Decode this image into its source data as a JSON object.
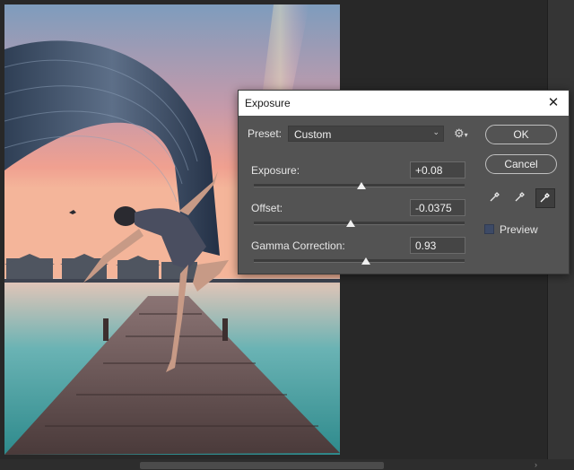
{
  "dialog": {
    "title": "Exposure",
    "preset_label": "Preset:",
    "preset_value": "Custom",
    "ok_label": "OK",
    "cancel_label": "Cancel",
    "preview_label": "Preview",
    "preview_checked": true,
    "exposure": {
      "label": "Exposure:",
      "value": "+0.08",
      "slider_fraction": 0.51
    },
    "offset": {
      "label": "Offset:",
      "value": "-0.0375",
      "slider_fraction": 0.46
    },
    "gamma": {
      "label": "Gamma Correction:",
      "value": "0.93",
      "slider_fraction": 0.53
    }
  },
  "colors": {
    "dialog_bg": "#535353",
    "workspace_bg": "#282828",
    "preview_check": "#3d4a66"
  },
  "icons": {
    "close": "close-icon",
    "gear": "gear-icon",
    "eyedroppers": [
      "black-point-eyedropper-icon",
      "gray-point-eyedropper-icon",
      "white-point-eyedropper-icon"
    ]
  }
}
